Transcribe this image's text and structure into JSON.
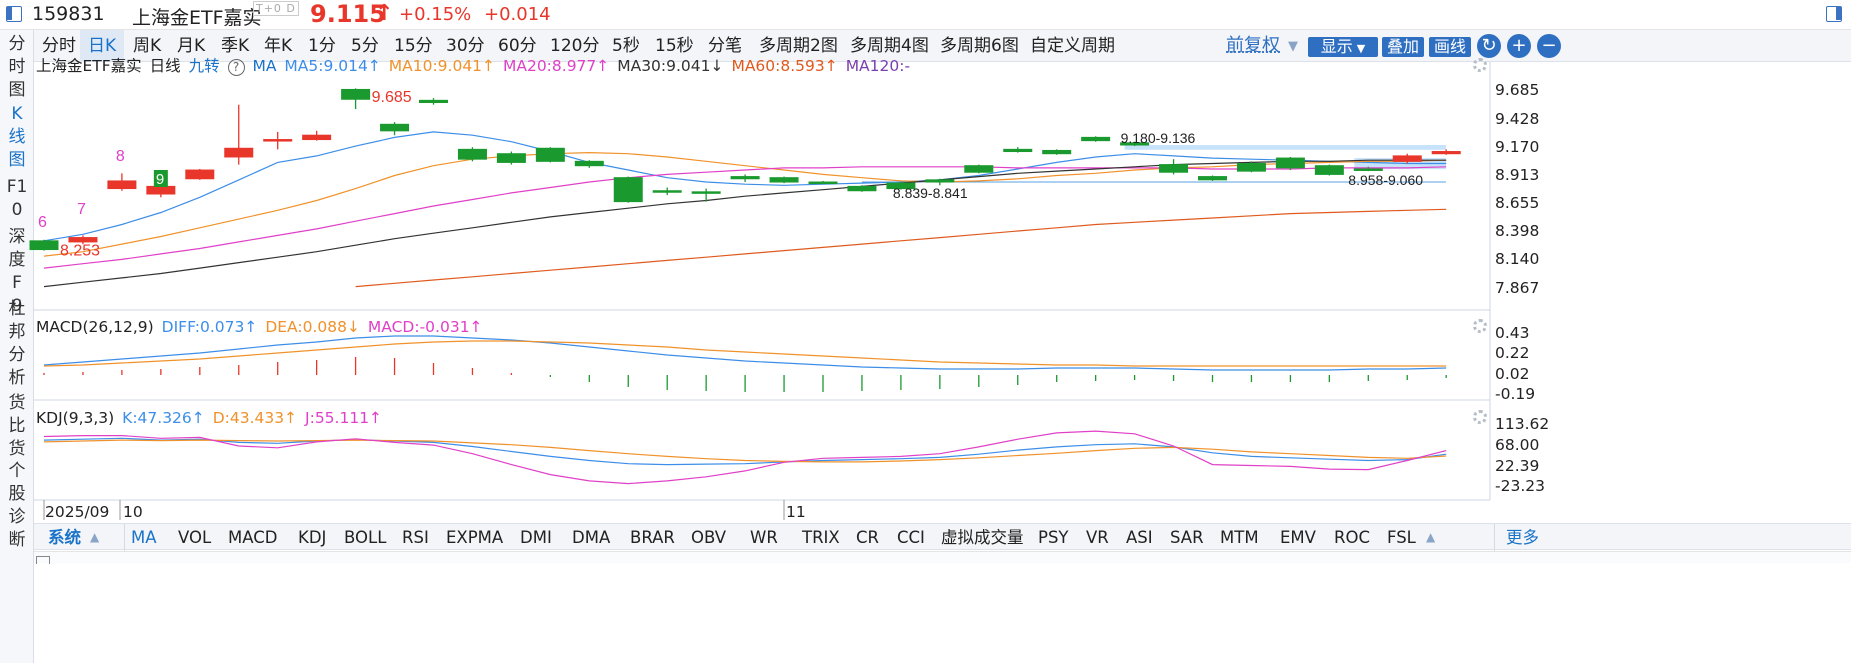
{
  "titlebar": {
    "code": "159831",
    "name": "上海金ETF嘉实",
    "badge": "T+0 D",
    "price": "9.115",
    "price_arrow": "↑",
    "change_pct": "+0.15%",
    "change": "+0.014"
  },
  "tabs": [
    "分时",
    "日K",
    "周K",
    "月K",
    "季K",
    "年K",
    "1分",
    "5分",
    "15分",
    "30分",
    "60分",
    "120分",
    "5秒",
    "15秒",
    "分笔",
    "多周期2图",
    "多周期4图",
    "多周期6图",
    "自定义周期"
  ],
  "active_tab": "日K",
  "toolbar": {
    "fuquan": "前复权",
    "xianshi": "显示",
    "diejia": "叠加",
    "huaxian": "画线"
  },
  "leftnav": [
    "分时图",
    "K线图",
    "F10",
    "深度F9",
    "杜邦分析",
    "货比货",
    "个股诊断"
  ],
  "main_legend": {
    "name": "上海金ETF嘉实",
    "period": "日线",
    "jiuzhuan": "九转",
    "ma": "MA",
    "ma5": "MA5:9.014↑",
    "ma10": "MA10:9.041↑",
    "ma20": "MA20:8.977↑",
    "ma30": "MA30:9.041↓",
    "ma60": "MA60:8.593↑",
    "ma120": "MA120:-"
  },
  "main_yticks": [
    "9.685",
    "9.428",
    "9.170",
    "8.913",
    "8.655",
    "8.398",
    "8.140",
    "7.867"
  ],
  "annotations": {
    "high": "9.685",
    "low": "8.253",
    "range1": "9.180-9.136",
    "range2": "8.839-8.841",
    "range3": "8.958-9.060",
    "nine": [
      "6",
      "7",
      "8",
      "9"
    ]
  },
  "macd_legend": {
    "name": "MACD(26,12,9)",
    "diff": "DIFF:0.073↑",
    "dea": "DEA:0.088↓",
    "macd": "MACD:-0.031↑"
  },
  "macd_yticks": [
    "0.43",
    "0.22",
    "0.02",
    "-0.19"
  ],
  "kdj_legend": {
    "name": "KDJ(9,3,3)",
    "k": "K:47.326↑",
    "d": "D:43.433↑",
    "j": "J:55.111↑"
  },
  "kdj_yticks": [
    "113.62",
    "68.00",
    "22.39",
    "-23.23"
  ],
  "xaxis": {
    "label1": "2025/09",
    "label2": "10",
    "label3": "11"
  },
  "bottombar": {
    "system": "系统",
    "indicators": [
      "MA",
      "VOL",
      "MACD",
      "KDJ",
      "BOLL",
      "RSI",
      "EXPMA",
      "DMI",
      "DMA",
      "BRAR",
      "OBV",
      "WR",
      "TRIX",
      "CR",
      "CCI",
      "虚拟成交量",
      "PSY",
      "VR",
      "ASI",
      "SAR",
      "MTM",
      "EMV",
      "ROC",
      "FSL"
    ],
    "more": "更多"
  },
  "colors": {
    "up": "#e8362b",
    "down": "#1a9a2e",
    "accent": "#1a73c8",
    "ma5": "#3d8ee8",
    "ma10": "#f0922b",
    "ma20": "#e040c8",
    "ma30": "#333333",
    "ma60": "#e05a1e",
    "button": "#2f6fc1"
  },
  "chart_data": [
    {
      "type": "candlestick",
      "title": "上海金ETF嘉实 日线",
      "ylim": [
        7.867,
        9.685
      ],
      "candles": [
        {
          "o": 8.3,
          "c": 8.22,
          "h": 8.31,
          "l": 8.21
        },
        {
          "o": 8.29,
          "c": 8.33,
          "h": 8.35,
          "l": 8.27
        },
        {
          "o": 8.78,
          "c": 8.85,
          "h": 8.92,
          "l": 8.76
        },
        {
          "o": 8.73,
          "c": 8.8,
          "h": 8.81,
          "l": 8.7
        },
        {
          "o": 8.87,
          "c": 8.95,
          "h": 8.96,
          "l": 8.86
        },
        {
          "o": 9.07,
          "c": 9.15,
          "h": 9.55,
          "l": 9.0
        },
        {
          "o": 9.22,
          "c": 9.23,
          "h": 9.3,
          "l": 9.14
        },
        {
          "o": 9.23,
          "c": 9.27,
          "h": 9.31,
          "l": 9.22
        },
        {
          "o": 9.69,
          "c": 9.6,
          "h": 9.7,
          "l": 9.51
        },
        {
          "o": 9.37,
          "c": 9.31,
          "h": 9.39,
          "l": 9.27
        },
        {
          "o": 9.59,
          "c": 9.57,
          "h": 9.61,
          "l": 9.55
        },
        {
          "o": 9.14,
          "c": 9.05,
          "h": 9.16,
          "l": 9.03
        },
        {
          "o": 9.1,
          "c": 9.02,
          "h": 9.12,
          "l": 9.0
        },
        {
          "o": 9.15,
          "c": 9.03,
          "h": 9.16,
          "l": 9.02
        },
        {
          "o": 9.03,
          "c": 8.99,
          "h": 9.04,
          "l": 8.97
        },
        {
          "o": 8.88,
          "c": 8.66,
          "h": 8.89,
          "l": 8.65
        },
        {
          "o": 8.76,
          "c": 8.75,
          "h": 8.79,
          "l": 8.72
        },
        {
          "o": 8.75,
          "c": 8.74,
          "h": 8.78,
          "l": 8.66
        },
        {
          "o": 8.89,
          "c": 8.87,
          "h": 8.91,
          "l": 8.84
        },
        {
          "o": 8.88,
          "c": 8.84,
          "h": 8.89,
          "l": 8.83
        },
        {
          "o": 8.84,
          "c": 8.83,
          "h": 8.85,
          "l": 8.82
        },
        {
          "o": 8.8,
          "c": 8.76,
          "h": 8.81,
          "l": 8.75
        },
        {
          "o": 8.83,
          "c": 8.78,
          "h": 8.84,
          "l": 8.77
        },
        {
          "o": 8.86,
          "c": 8.84,
          "h": 8.87,
          "l": 8.81
        },
        {
          "o": 8.99,
          "c": 8.93,
          "h": 9.0,
          "l": 8.92
        },
        {
          "o": 9.14,
          "c": 9.12,
          "h": 9.16,
          "l": 9.11
        },
        {
          "o": 9.13,
          "c": 9.1,
          "h": 9.14,
          "l": 9.09
        },
        {
          "o": 9.25,
          "c": 9.22,
          "h": 9.26,
          "l": 9.21
        },
        {
          "o": 9.2,
          "c": 9.18,
          "h": 9.21,
          "l": 9.17
        },
        {
          "o": 9.0,
          "c": 8.93,
          "h": 9.05,
          "l": 8.91
        },
        {
          "o": 8.89,
          "c": 8.86,
          "h": 8.9,
          "l": 8.85
        },
        {
          "o": 9.01,
          "c": 8.94,
          "h": 9.03,
          "l": 8.93
        },
        {
          "o": 9.06,
          "c": 8.97,
          "h": 9.07,
          "l": 8.95
        },
        {
          "o": 8.99,
          "c": 8.91,
          "h": 9.0,
          "l": 8.9
        },
        {
          "o": 8.96,
          "c": 8.95,
          "h": 8.98,
          "l": 8.94
        },
        {
          "o": 9.03,
          "c": 9.08,
          "h": 9.1,
          "l": 9.01
        },
        {
          "o": 9.1,
          "c": 9.12,
          "h": 9.14,
          "l": 9.09
        }
      ],
      "series": [
        {
          "name": "MA5",
          "values": [
            8.3,
            8.36,
            8.45,
            8.56,
            8.7,
            8.86,
            9.02,
            9.08,
            9.17,
            9.25,
            9.3,
            9.27,
            9.21,
            9.12,
            9.02,
            8.95,
            8.88,
            8.84,
            8.82,
            8.81,
            8.82,
            8.83,
            8.84,
            8.86,
            8.9,
            8.96,
            9.02,
            9.07,
            9.1,
            9.08,
            9.06,
            9.05,
            9.04,
            9.03,
            9.02,
            9.01,
            9.01
          ]
        },
        {
          "name": "MA10",
          "values": [
            8.16,
            8.2,
            8.27,
            8.34,
            8.42,
            8.5,
            8.58,
            8.67,
            8.78,
            8.9,
            8.99,
            9.05,
            9.08,
            9.1,
            9.11,
            9.1,
            9.07,
            9.03,
            8.99,
            8.95,
            8.91,
            8.88,
            8.85,
            8.84,
            8.85,
            8.87,
            8.9,
            8.92,
            8.95,
            8.97,
            8.98,
            9.0,
            9.01,
            9.02,
            9.03,
            9.03,
            9.04
          ]
        },
        {
          "name": "MA20",
          "values": [
            8.05,
            8.09,
            8.13,
            8.18,
            8.23,
            8.29,
            8.35,
            8.41,
            8.48,
            8.55,
            8.62,
            8.68,
            8.74,
            8.79,
            8.84,
            8.88,
            8.91,
            8.93,
            8.95,
            8.97,
            8.97,
            8.98,
            8.98,
            8.98,
            8.98,
            8.97,
            8.97,
            8.97,
            8.97,
            8.97,
            8.96,
            8.96,
            8.96,
            8.97,
            8.97,
            8.97,
            8.98
          ]
        },
        {
          "name": "MA30",
          "values": [
            7.88,
            7.92,
            7.96,
            8.0,
            8.05,
            8.1,
            8.15,
            8.2,
            8.26,
            8.32,
            8.37,
            8.42,
            8.47,
            8.52,
            8.56,
            8.6,
            8.64,
            8.67,
            8.71,
            8.74,
            8.77,
            8.8,
            8.83,
            8.86,
            8.89,
            8.92,
            8.94,
            8.96,
            8.98,
            9.0,
            9.01,
            9.02,
            9.03,
            9.03,
            9.04,
            9.04,
            9.04
          ]
        },
        {
          "name": "MA60",
          "values": [
            null,
            null,
            null,
            null,
            null,
            null,
            null,
            null,
            7.88,
            7.91,
            7.94,
            7.97,
            8.0,
            8.03,
            8.06,
            8.09,
            8.12,
            8.15,
            8.18,
            8.21,
            8.24,
            8.27,
            8.3,
            8.33,
            8.36,
            8.39,
            8.42,
            8.45,
            8.47,
            8.49,
            8.51,
            8.53,
            8.55,
            8.56,
            8.57,
            8.58,
            8.59
          ]
        }
      ]
    },
    {
      "type": "bar",
      "title": "MACD(26,12,9)",
      "ylim": [
        -0.19,
        0.43
      ],
      "series": [
        {
          "name": "DIFF",
          "values": [
            0.1,
            0.13,
            0.16,
            0.19,
            0.22,
            0.26,
            0.3,
            0.33,
            0.37,
            0.39,
            0.39,
            0.37,
            0.35,
            0.32,
            0.28,
            0.24,
            0.2,
            0.17,
            0.14,
            0.12,
            0.1,
            0.08,
            0.07,
            0.06,
            0.06,
            0.06,
            0.07,
            0.07,
            0.07,
            0.06,
            0.05,
            0.05,
            0.05,
            0.05,
            0.06,
            0.06,
            0.07
          ]
        },
        {
          "name": "DEA",
          "values": [
            0.09,
            0.1,
            0.12,
            0.14,
            0.16,
            0.19,
            0.22,
            0.25,
            0.28,
            0.31,
            0.33,
            0.34,
            0.34,
            0.33,
            0.32,
            0.3,
            0.28,
            0.25,
            0.23,
            0.21,
            0.19,
            0.17,
            0.15,
            0.13,
            0.12,
            0.11,
            0.1,
            0.1,
            0.09,
            0.09,
            0.09,
            0.09,
            0.09,
            0.09,
            0.09,
            0.09,
            0.09
          ]
        },
        {
          "name": "MACD",
          "values": [
            0.02,
            0.03,
            0.05,
            0.06,
            0.08,
            0.1,
            0.13,
            0.15,
            0.18,
            0.17,
            0.12,
            0.07,
            0.02,
            -0.02,
            -0.07,
            -0.12,
            -0.15,
            -0.16,
            -0.17,
            -0.17,
            -0.17,
            -0.16,
            -0.15,
            -0.14,
            -0.12,
            -0.1,
            -0.07,
            -0.06,
            -0.05,
            -0.06,
            -0.07,
            -0.07,
            -0.07,
            -0.07,
            -0.06,
            -0.05,
            -0.03
          ]
        }
      ]
    },
    {
      "type": "line",
      "title": "KDJ(9,3,3)",
      "ylim": [
        -23.23,
        113.62
      ],
      "series": [
        {
          "name": "K",
          "values": [
            78,
            80,
            82,
            78,
            80,
            73,
            71,
            76,
            79,
            76,
            73,
            64,
            53,
            42,
            33,
            26,
            24,
            25,
            26,
            30,
            33,
            35,
            37,
            40,
            47,
            56,
            63,
            68,
            70,
            63,
            50,
            42,
            39,
            36,
            33,
            35,
            47
          ]
        },
        {
          "name": "D",
          "values": [
            74,
            76,
            78,
            77,
            78,
            77,
            76,
            77,
            78,
            77,
            76,
            72,
            68,
            62,
            55,
            48,
            42,
            37,
            33,
            31,
            30,
            30,
            32,
            35,
            39,
            44,
            49,
            55,
            60,
            62,
            58,
            52,
            48,
            44,
            40,
            38,
            43
          ]
        },
        {
          "name": "J",
          "values": [
            86,
            88,
            88,
            82,
            84,
            65,
            61,
            74,
            81,
            73,
            67,
            48,
            24,
            2,
            -12,
            -18,
            -12,
            -3,
            10,
            29,
            38,
            40,
            42,
            48,
            63,
            80,
            94,
            98,
            92,
            65,
            24,
            22,
            20,
            14,
            13,
            33,
            55
          ]
        }
      ]
    }
  ]
}
